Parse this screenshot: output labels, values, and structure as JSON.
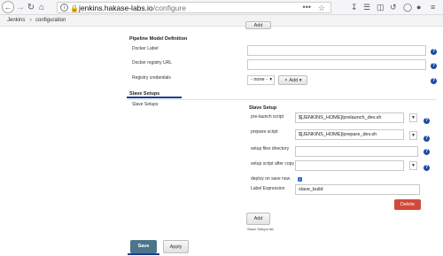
{
  "browser": {
    "url_host": "jenkins.hakase-labs.io",
    "url_path": "/configure",
    "url_menu_glyph": "•••",
    "icons": [
      "back-icon",
      "forward-icon",
      "reload-icon",
      "info-icon",
      "lock-icon",
      "bookmark-star-icon",
      "download-icon",
      "library-icon",
      "sidebar-icon",
      "sync-icon",
      "account-icon",
      "menu-icon"
    ]
  },
  "breadcrumb": {
    "items": [
      "Jenkins",
      "configuration"
    ],
    "separator": "»"
  },
  "top_add": {
    "label": "Add"
  },
  "pipeline": {
    "title": "Pipeline Model Definition",
    "docker_label": "Docker Label",
    "docker_label_value": "",
    "docker_registry_url": "Docker registry URL",
    "docker_registry_url_value": "",
    "registry_credentials": "Registry credentials",
    "credentials_selected": "- none -",
    "credentials_add": "Add"
  },
  "slave": {
    "section_title": "Slave Setups",
    "row_label": "Slave Setups",
    "panel_title": "Slave Setup",
    "pre_launch_label": "pre-launch script",
    "pre_launch_value": "$[JENKINS_HOME]/prelaunch_dev.sh",
    "prepare_label": "prepare script",
    "prepare_value": "$[JENKINS_HOME]/prepare_dev.sh",
    "files_dir_label": "setup files directory",
    "files_dir_value": "",
    "after_copy_label": "setup script after copy",
    "after_copy_value": "",
    "deploy_label": "deploy on save now",
    "deploy_checked": true,
    "label_expr_label": "Label Expression",
    "label_expr_value": "slave_build",
    "delete_label": "Delete",
    "add_label": "Add",
    "list_caption": "Slave Setups list"
  },
  "footer": {
    "save": "Save",
    "apply": "Apply"
  },
  "colors": {
    "accent": "#1b3f8e",
    "help": "#1e4aa8",
    "delete": "#d24939",
    "save": "#4b758b"
  }
}
